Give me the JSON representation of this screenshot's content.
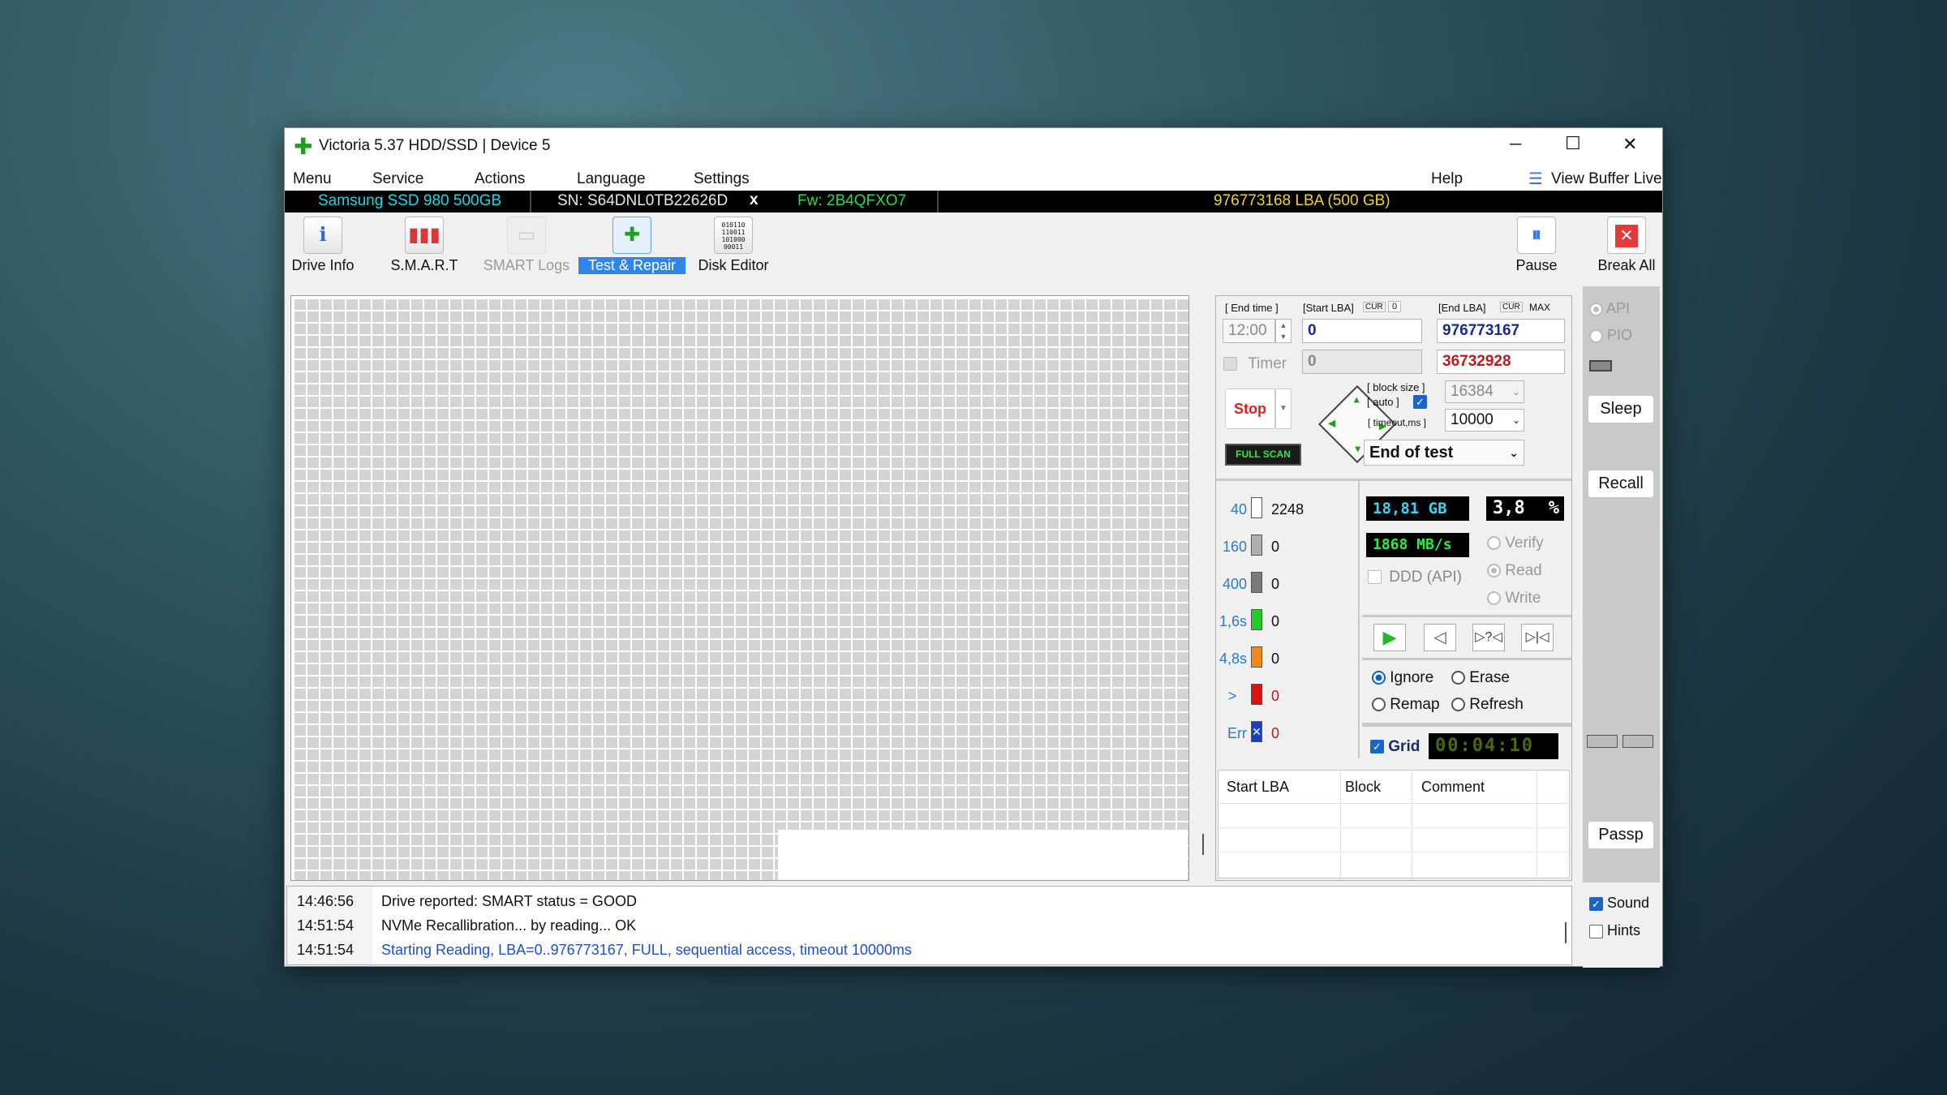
{
  "window": {
    "title": "Victoria 5.37 HDD/SSD | Device 5",
    "minimize_glyph": "─",
    "maximize_glyph": "☐",
    "close_glyph": "✕"
  },
  "menu": {
    "items": [
      "Menu",
      "Service",
      "Actions",
      "Language",
      "Settings"
    ],
    "help": "Help",
    "view_buffer": "View Buffer Live"
  },
  "device": {
    "model": "Samsung SSD 980 500GB",
    "serial": "SN: S64DNL0TB22626D",
    "x": "x",
    "firmware": "Fw: 2B4QFXO7",
    "capacity": "976773168 LBA (500 GB)"
  },
  "toolbar": {
    "drive_info": "Drive Info",
    "smart": "S.M.A.R.T",
    "smart_logs": "SMART Logs",
    "test_repair": "Test & Repair",
    "disk_editor": "Disk Editor",
    "pause": "Pause",
    "break_all": "Break All",
    "disk_editor_glyph": "010110\n110011\n101000\n00011"
  },
  "scan": {
    "end_time_label": "[ End time ]",
    "start_lba_label": "[Start LBA]",
    "cur_label": "CUR",
    "cur_value": "0",
    "end_lba_label": "[End LBA]",
    "cur2_label": "CUR",
    "max_label": "MAX",
    "end_time": "12:00",
    "start_lba": "0",
    "end_lba": "976773167",
    "timer_label": "Timer",
    "timer_value": "0",
    "current_lba": "36732928",
    "stop": "Stop",
    "full_scan": "FULL SCAN",
    "block_size_label": "[ block size ]",
    "auto_label": "[ auto ]",
    "timeout_label": "[ timeout,ms ]",
    "block_size": "16384",
    "timeout": "10000",
    "end_action": "End of test"
  },
  "stats": {
    "rows": [
      {
        "label": "40",
        "count": "2248",
        "color": "#ffffff"
      },
      {
        "label": "160",
        "count": "0",
        "color": "#b0b0b0"
      },
      {
        "label": "400",
        "count": "0",
        "color": "#7a7a7a"
      },
      {
        "label": "1,6s",
        "count": "0",
        "color": "#22cc22"
      },
      {
        "label": "4,8s",
        "count": "0",
        "color": "#f08a1c"
      },
      {
        "label": ">",
        "count": "0",
        "color": "#e01010"
      },
      {
        "label": "Err",
        "count": "0",
        "color": "#1a3cc8"
      }
    ],
    "gb": "18,81 GB",
    "percent": "3,8",
    "percent_sign": "%",
    "speed": "1868 MB/s",
    "verify": "Verify",
    "read": "Read",
    "write": "Write",
    "ddd": "DDD (API)",
    "ignore": "Ignore",
    "erase": "Erase",
    "remap": "Remap",
    "refresh": "Refresh",
    "grid": "Grid",
    "elapsed": "00:04:10"
  },
  "table": {
    "headers": [
      "Start LBA",
      "Block",
      "Comment"
    ]
  },
  "side": {
    "api": "API",
    "pio": "PIO",
    "sleep": "Sleep",
    "recall": "Recall",
    "passp": "Passp",
    "sound": "Sound",
    "hints": "Hints"
  },
  "log": [
    {
      "time": "14:46:56",
      "text": "Drive reported: SMART status = GOOD",
      "color": "#111111"
    },
    {
      "time": "14:51:54",
      "text": "NVMe Recallibration...  by reading... OK",
      "color": "#111111"
    },
    {
      "time": "14:51:54",
      "text": "Starting Reading, LBA=0..976773167, FULL, sequential access, timeout 10000ms",
      "color": "#1c4fd0"
    }
  ]
}
